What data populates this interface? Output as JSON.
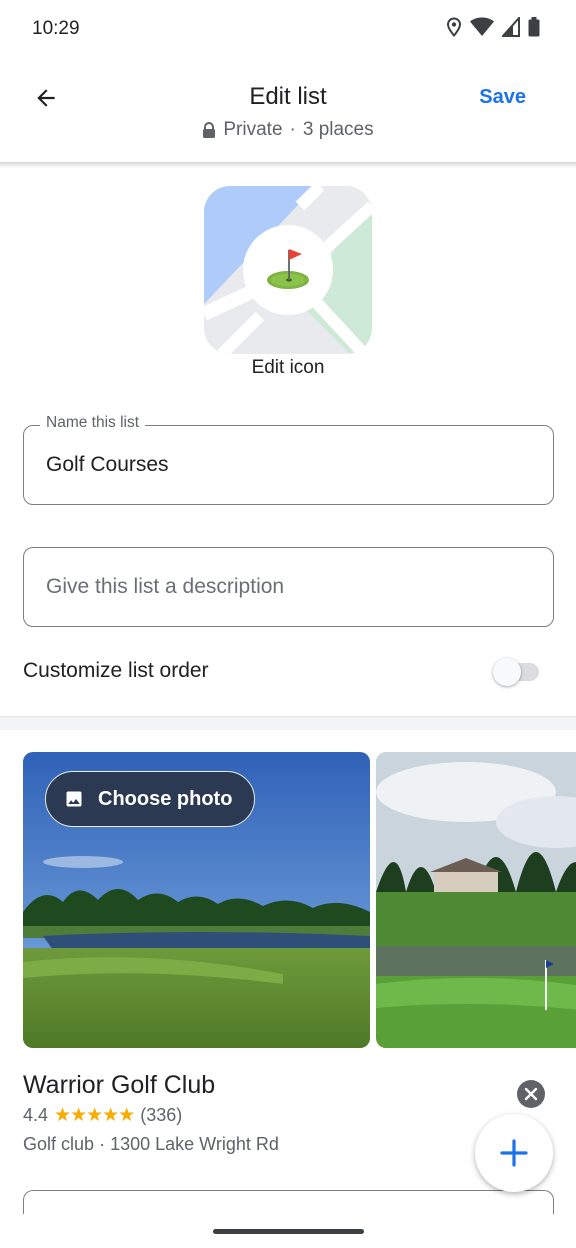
{
  "status_bar": {
    "time": "10:29",
    "icons": [
      "location-icon",
      "wifi-icon",
      "signal-icon",
      "battery-icon"
    ]
  },
  "header": {
    "back_icon": "arrow-back-icon",
    "title": "Edit list",
    "subtitle_privacy": "Private",
    "subtitle_separator": "·",
    "subtitle_count": "3 places",
    "save_label": "Save"
  },
  "list_icon": {
    "icon": "golf-flag-icon",
    "edit_label": "Edit icon"
  },
  "form": {
    "name_legend": "Name this list",
    "name_value": "Golf Courses",
    "description_placeholder": "Give this list a description",
    "customize_label": "Customize list order",
    "customize_enabled": false
  },
  "photos": {
    "choose_photo_label": "Choose photo",
    "choose_photo_icon": "image-icon"
  },
  "place": {
    "name": "Warrior Golf Club",
    "rating": "4.4",
    "stars_value": 4.4,
    "stars_display": "★★★★★",
    "review_count": "(336)",
    "category": "Golf club",
    "separator": "·",
    "address": "1300 Lake Wright Rd"
  },
  "fab": {
    "icon": "add-icon"
  },
  "colors": {
    "accent": "#1a73e8",
    "star": "#f9ab00",
    "chip_bg": "#2b3a52",
    "text_primary": "#202124",
    "text_secondary": "#5f6368"
  }
}
